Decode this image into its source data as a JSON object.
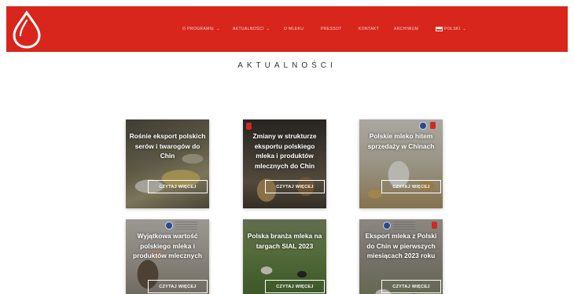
{
  "header": {
    "background": "#d9261c",
    "logo_icon": "milk-drop-logo-icon",
    "nav": [
      {
        "label": "O PROGRAMIE",
        "dropdown": true
      },
      {
        "label": "AKTUALNOŚCI",
        "dropdown": true
      },
      {
        "label": "O MLEKU",
        "dropdown": false
      },
      {
        "label": "PRESSOT",
        "dropdown": false
      },
      {
        "label": "KONTAKT",
        "dropdown": false
      },
      {
        "label": "ARCHIWUM",
        "dropdown": false
      },
      {
        "label": "POLSKI",
        "dropdown": true,
        "flag": "polish-flag-icon"
      }
    ]
  },
  "section": {
    "title": "AKTUALNOŚCI"
  },
  "cards": [
    {
      "title": "Rośnie eksport polskich serów i twarogów do Chin",
      "button": "CZYTAJ WIĘCEJ"
    },
    {
      "title": "Zmiany w strukturze eksportu polskiego mleka i produktów mlecznych do Chin",
      "button": "CZYTAJ WIĘCEJ"
    },
    {
      "title": "Polskie mleko hitem sprzedaży w Chinach",
      "button": "CZYTAJ WIĘCEJ"
    },
    {
      "title": "Wyjątkowa wartość polskiego mleka i produktów mlecznych",
      "button": "CZYTAJ WIĘCEJ"
    },
    {
      "title": "Polska branża mleka na targach SIAL 2023",
      "button": "CZYTAJ WIĘCEJ"
    },
    {
      "title": "Eksport mleka z Polski do Chin w pierwszych miesiącach 2023 roku",
      "button": "CZYTAJ WIĘCEJ"
    }
  ]
}
